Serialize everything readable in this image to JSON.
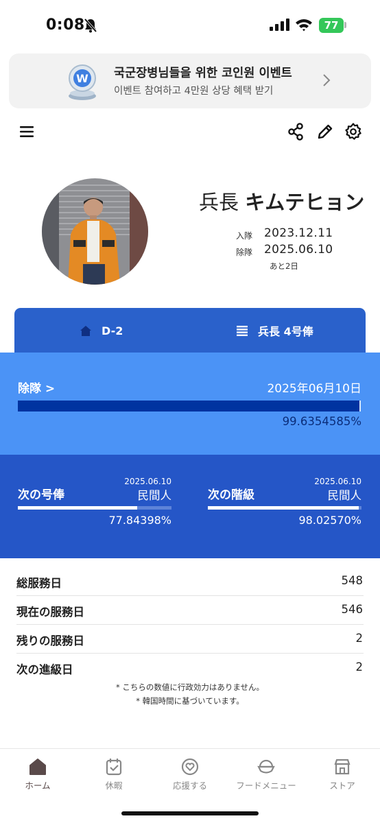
{
  "status_bar": {
    "time": "0:08",
    "battery": "77",
    "icons": [
      "bell-slash-icon",
      "signal-icon",
      "wifi-icon",
      "battery-icon"
    ]
  },
  "banner": {
    "title": "국군장병님들을 위한 코인원 이벤트",
    "subtitle": "이벤트 참여하고 4만원 상당 혜택 받기",
    "icons": [
      "coin-trophy-icon",
      "chevron-right-icon"
    ]
  },
  "toolbar": {
    "icons": [
      "menu-icon",
      "share-icon",
      "edit-icon",
      "settings-icon"
    ]
  },
  "profile": {
    "rank": "兵長",
    "name": "キムテヒョン",
    "enlist_label": "入隊",
    "enlist_date": "2023.12.11",
    "discharge_label": "除隊",
    "discharge_date": "2025.06.10",
    "remaining": "あと2日"
  },
  "tabs": {
    "dday": "D-2",
    "rank_pay": "兵長 4号俸",
    "icons": [
      "home-icon",
      "list-icon"
    ]
  },
  "discharge": {
    "label": "除隊 >",
    "date": "2025年06月10日",
    "percent_text": "99.6354585%",
    "progress": 0.996354585
  },
  "next_pay": {
    "label": "次の号俸",
    "date": "2025.06.10",
    "value": "民間人",
    "percent_text": "77.84398%",
    "progress": 0.7784398
  },
  "next_rank": {
    "label": "次の階級",
    "date": "2025.06.10",
    "value": "民間人",
    "percent_text": "98.02570%",
    "progress": 0.980257
  },
  "stats": [
    {
      "label": "総服務日",
      "value": "548"
    },
    {
      "label": "現在の服務日",
      "value": "546"
    },
    {
      "label": "残りの服務日",
      "value": "2"
    },
    {
      "label": "次の進級日",
      "value": "2"
    }
  ],
  "notes": [
    "* こちらの数値に行政効力はありません。",
    "* 韓国時間に基づいています。"
  ],
  "bottom_nav": [
    {
      "label": "ホーム",
      "icon": "home-icon",
      "active": true
    },
    {
      "label": "休暇",
      "icon": "calendar-check-icon",
      "active": false
    },
    {
      "label": "応援する",
      "icon": "heart-badge-icon",
      "active": false
    },
    {
      "label": "フードメニュー",
      "icon": "rice-bowl-icon",
      "active": false
    },
    {
      "label": "ストア",
      "icon": "store-icon",
      "active": false
    }
  ],
  "colors": {
    "tab_blue": "#2a61cb",
    "discharge_bg": "#4b93f6",
    "progress_dark": "#0033a0",
    "next_bg": "#2556c7",
    "battery_green": "#34c759"
  }
}
